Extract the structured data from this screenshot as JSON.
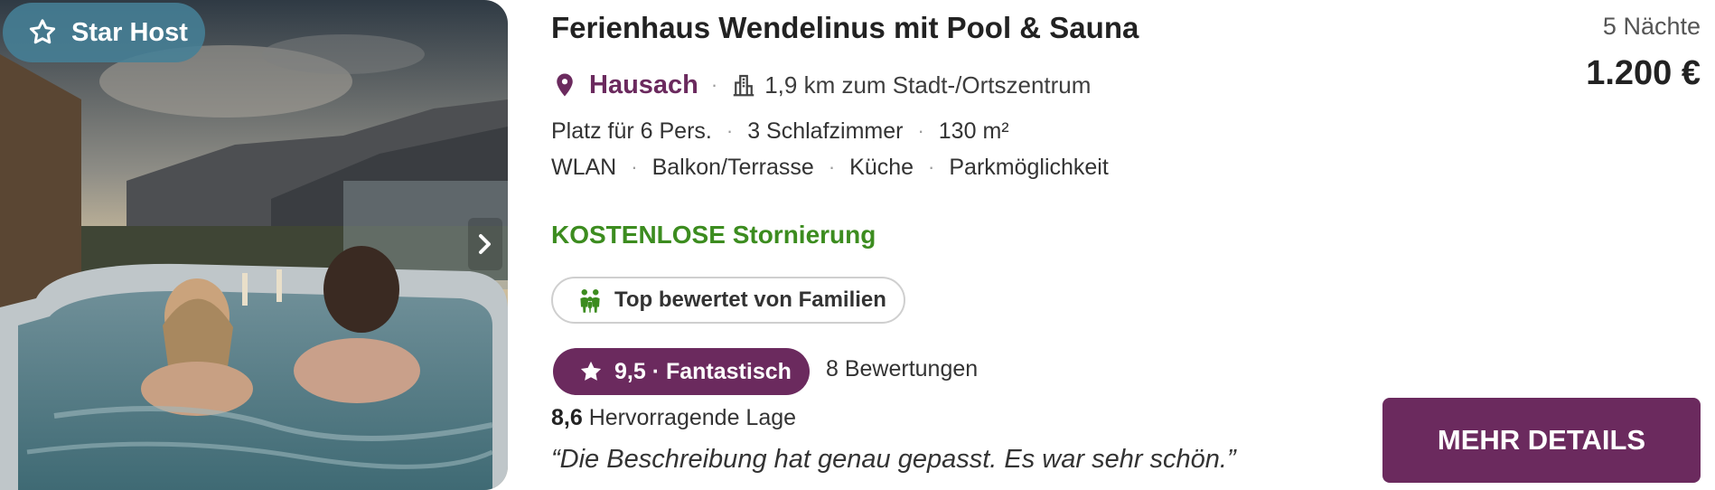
{
  "listing": {
    "badge": {
      "label": "Star Host",
      "icon": "star-outline-icon"
    },
    "title": "Ferienhaus Wendelinus mit Pool & Sauna",
    "location": {
      "name": "Hausach",
      "icon": "map-pin-icon",
      "distance_icon": "buildings-icon",
      "distance": "1,9 km zum Stadt-/Ortszentrum"
    },
    "separator": "·",
    "capacity": [
      "Platz für 6 Pers.",
      "3 Schlafzimmer",
      "130 m²"
    ],
    "amenities": [
      "WLAN",
      "Balkon/Terrasse",
      "Küche",
      "Parkmöglichkeit"
    ],
    "cancellation": "KOSTENLOSE Stornierung",
    "family_badge": {
      "label": "Top bewertet von Familien",
      "icon": "family-icon"
    },
    "rating": {
      "score": "9,5",
      "label": "Fantastisch",
      "pill_text": "9,5 · Fantastisch",
      "icon": "star-icon",
      "reviews": "8 Bewertungen"
    },
    "location_score": {
      "value": "8,6",
      "label": "Hervorragende Lage"
    },
    "quote": "“Die Beschreibung hat genau gepasst. Es war sehr schön.”",
    "price": {
      "nights": "5 Nächte",
      "amount": "1.200 €"
    },
    "cta": {
      "label": "MEHR DETAILS"
    }
  },
  "colors": {
    "brand": "#6b2a5e",
    "cancellation": "#3c8c1f",
    "badge": "#4680a0",
    "text": "#222222"
  }
}
